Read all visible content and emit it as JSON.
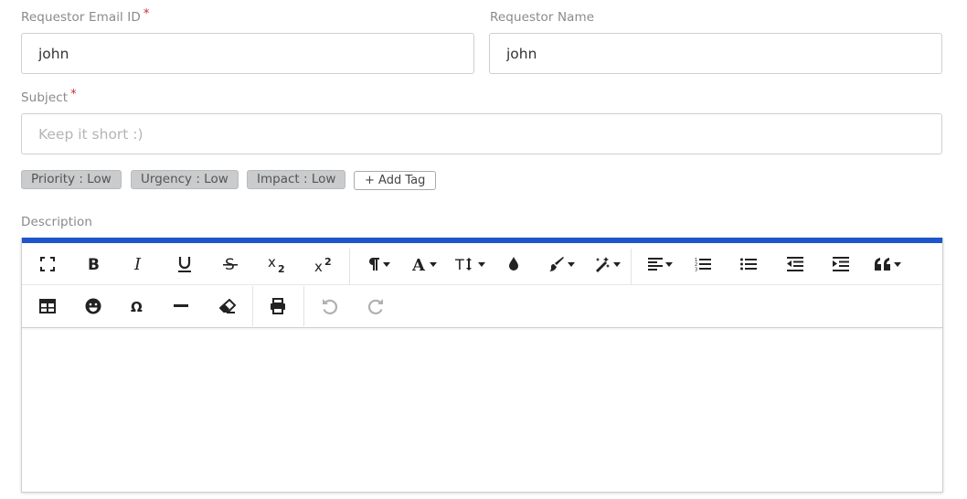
{
  "form": {
    "email_label": "Requestor Email ID",
    "email_required": "*",
    "email_value": "john",
    "name_label": "Requestor Name",
    "name_value": "john",
    "subject_label": "Subject",
    "subject_required": "*",
    "subject_value": "",
    "subject_placeholder": "Keep it short :)",
    "description_label": "Description"
  },
  "tags": [
    {
      "label": "Priority : Low"
    },
    {
      "label": "Urgency : Low"
    },
    {
      "label": "Impact : Low"
    }
  ],
  "add_tag_label": "+ Add Tag",
  "editor": {
    "accent_color": "#1e55cc",
    "toolbar_row1": [
      "fullscreen-icon",
      "bold-icon",
      "italic-icon",
      "underline-icon",
      "strikethrough-icon",
      "subscript-icon",
      "superscript-icon",
      "paragraph-format-icon",
      "font-family-icon",
      "font-size-icon",
      "text-color-icon",
      "background-color-icon",
      "inline-style-icon",
      "align-icon",
      "ordered-list-icon",
      "unordered-list-icon",
      "outdent-icon",
      "indent-icon",
      "quote-icon"
    ],
    "toolbar_row2": [
      "insert-table-icon",
      "emoticons-icon",
      "special-characters-icon",
      "horizontal-line-icon",
      "clear-formatting-icon",
      "print-icon",
      "undo-icon",
      "redo-icon"
    ],
    "content": ""
  }
}
